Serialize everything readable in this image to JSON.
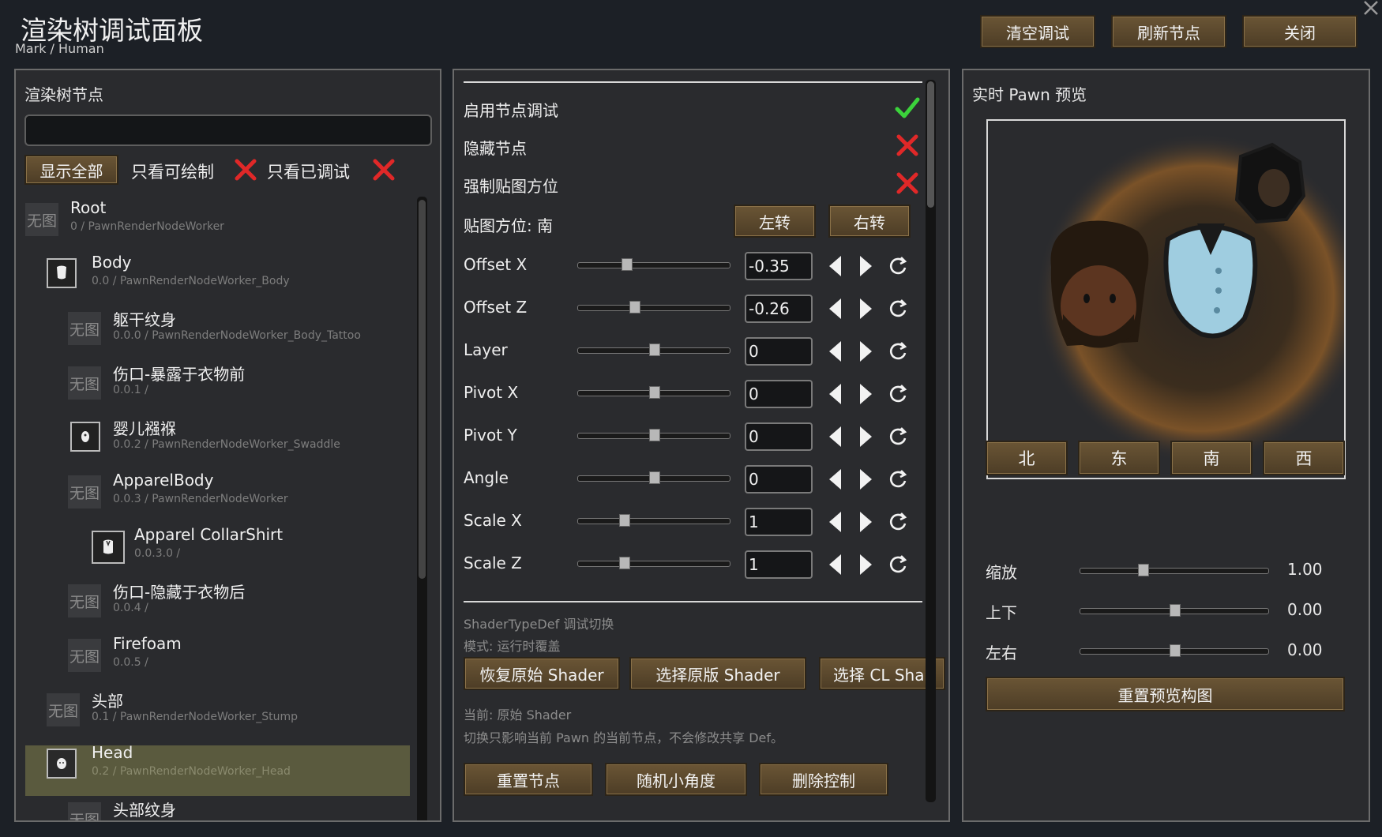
{
  "window": {
    "title": "渲染树调试面板",
    "breadcrumb": "Mark / Human"
  },
  "header_buttons": {
    "clear": "清空调试",
    "refresh": "刷新节点",
    "close": "关闭"
  },
  "left": {
    "title": "渲染树节点",
    "search": {
      "value": "",
      "placeholder": ""
    },
    "filters": {
      "show_all": "显示全部",
      "drawable_only": "只看可绘制",
      "debugged_only": "只看已调试"
    },
    "no_image": "无图",
    "nodes": [
      {
        "name": "Root",
        "sub": "0 / PawnRenderNodeWorker",
        "icon": "no-image"
      },
      {
        "name": "Body",
        "sub": "0.0 / PawnRenderNodeWorker_Body",
        "icon": "body-thumb"
      },
      {
        "name": "躯干纹身",
        "sub": "0.0.0 / PawnRenderNodeWorker_Body_Tattoo",
        "icon": "no-image"
      },
      {
        "name": "伤口-暴露于衣物前",
        "sub": "0.0.1 /",
        "icon": "no-image"
      },
      {
        "name": "婴儿襁褓",
        "sub": "0.0.2 / PawnRenderNodeWorker_Swaddle",
        "icon": "swaddle-thumb"
      },
      {
        "name": "ApparelBody",
        "sub": "0.0.3 / PawnRenderNodeWorker",
        "icon": "no-image"
      },
      {
        "name": "Apparel  CollarShirt",
        "sub": "0.0.3.0 /",
        "icon": "shirt-thumb"
      },
      {
        "name": "伤口-隐藏于衣物后",
        "sub": "0.0.4 /",
        "icon": "no-image"
      },
      {
        "name": "Firefoam",
        "sub": "0.0.5 /",
        "icon": "no-image"
      },
      {
        "name": "头部",
        "sub": "0.1 / PawnRenderNodeWorker_Stump",
        "icon": "no-image"
      },
      {
        "name": "Head",
        "sub": "0.2 / PawnRenderNodeWorker_Head",
        "icon": "head-thumb"
      },
      {
        "name": "头部纹身",
        "sub": "",
        "icon": "no-image"
      }
    ]
  },
  "middle": {
    "enable_debug": "启用节点调试",
    "hide_node": "隐藏节点",
    "force_facing": "强制贴图方位",
    "facing_label": "贴图方位: 南",
    "rotate_left": "左转",
    "rotate_right": "右转",
    "params": [
      {
        "label": "Offset X",
        "value": "-0.35",
        "level": 0.32
      },
      {
        "label": "Offset Z",
        "value": "-0.26",
        "level": 0.37
      },
      {
        "label": "Layer",
        "value": "0",
        "level": 0.5
      },
      {
        "label": "Pivot X",
        "value": "0",
        "level": 0.5
      },
      {
        "label": "Pivot Y",
        "value": "0",
        "level": 0.5
      },
      {
        "label": "Angle",
        "value": "0",
        "level": 0.5
      },
      {
        "label": "Scale X",
        "value": "1",
        "level": 0.3
      },
      {
        "label": "Scale Z",
        "value": "1",
        "level": 0.3
      }
    ],
    "shader_title": "ShaderTypeDef 调试切换",
    "shader_mode": "模式: 运行时覆盖",
    "shader_buttons": [
      "恢复原始 Shader",
      "选择原版 Shader",
      "选择 CL Sha"
    ],
    "shader_current": "当前: 原始 Shader",
    "shader_note": "切换只影响当前 Pawn 的当前节点，不会修改共享 Def。",
    "actions": [
      "重置节点",
      "随机小角度",
      "删除控制"
    ]
  },
  "right": {
    "title": "实时 Pawn 预览",
    "directions": [
      "北",
      "东",
      "南",
      "西"
    ],
    "sliders": [
      {
        "label": "缩放",
        "value": "1.00",
        "level": 0.33
      },
      {
        "label": "上下",
        "value": "0.00",
        "level": 0.5
      },
      {
        "label": "左右",
        "value": "0.00",
        "level": 0.5
      }
    ],
    "reset_preview": "重置预览构图"
  },
  "colors": {
    "accent_button": "#5c4a2e",
    "check_green": "#3bd23b",
    "cross_red": "#e02828",
    "selection": "#5a5a3e"
  }
}
